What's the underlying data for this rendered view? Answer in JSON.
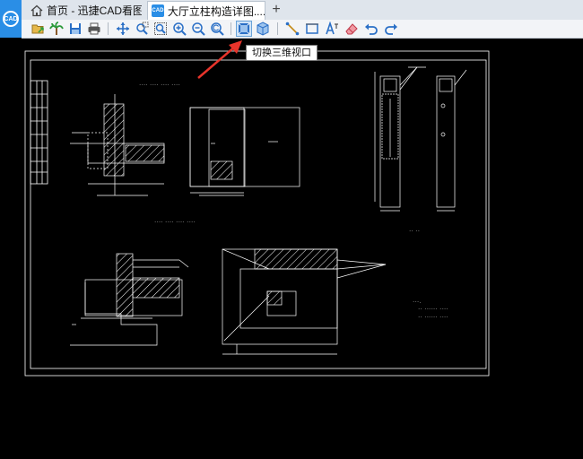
{
  "app": {
    "logo_text": "CAD"
  },
  "tabs": [
    {
      "label": "首页 - 迅捷CAD看图",
      "icon": "home-icon"
    },
    {
      "label": "大厅立柱构造详图....",
      "icon": "cad-file-icon",
      "icon_text": "CAD"
    }
  ],
  "add_tab": "+",
  "toolbar": {
    "buttons": [
      "open-file-icon",
      "palm-tree-icon",
      "save-icon",
      "print-icon",
      "pan-icon",
      "zoom-window-icon",
      "zoom-extents-icon",
      "zoom-in-icon",
      "zoom-out-icon",
      "zoom-previous-icon",
      "switch-3d-view-icon",
      "3d-view-icon",
      "measure-icon",
      "rectangle-icon",
      "text-icon",
      "eraser-icon",
      "undo-icon",
      "redo-icon"
    ]
  },
  "tooltip": {
    "text": "切换三维视口"
  },
  "colors": {
    "accent": "#2a8ee6",
    "arrow": "#e8342b",
    "canvas": "#000000",
    "line": "#ffffff"
  }
}
